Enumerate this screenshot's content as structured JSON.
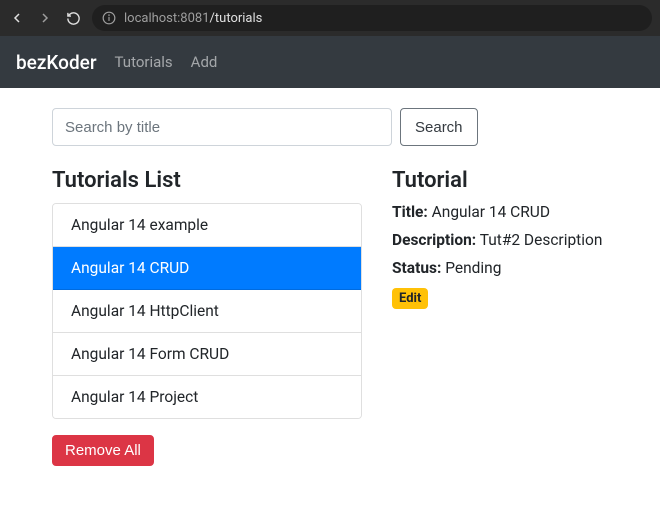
{
  "browser": {
    "url_host": "localhost",
    "url_port": ":8081",
    "url_path": "/tutorials"
  },
  "navbar": {
    "brand": "bezKoder",
    "links": [
      {
        "label": "Tutorials"
      },
      {
        "label": "Add"
      }
    ]
  },
  "search": {
    "placeholder": "Search by title",
    "value": "",
    "button": "Search"
  },
  "list": {
    "heading": "Tutorials List",
    "items": [
      {
        "title": "Angular 14 example",
        "active": false
      },
      {
        "title": "Angular 14 CRUD",
        "active": true
      },
      {
        "title": "Angular 14 HttpClient",
        "active": false
      },
      {
        "title": "Angular 14 Form CRUD",
        "active": false
      },
      {
        "title": "Angular 14 Project",
        "active": false
      }
    ],
    "remove_all": "Remove All"
  },
  "detail": {
    "heading": "Tutorial",
    "title_label": "Title:",
    "title_value": "Angular 14 CRUD",
    "description_label": "Description:",
    "description_value": "Tut#2 Description",
    "status_label": "Status:",
    "status_value": "Pending",
    "edit": "Edit"
  }
}
